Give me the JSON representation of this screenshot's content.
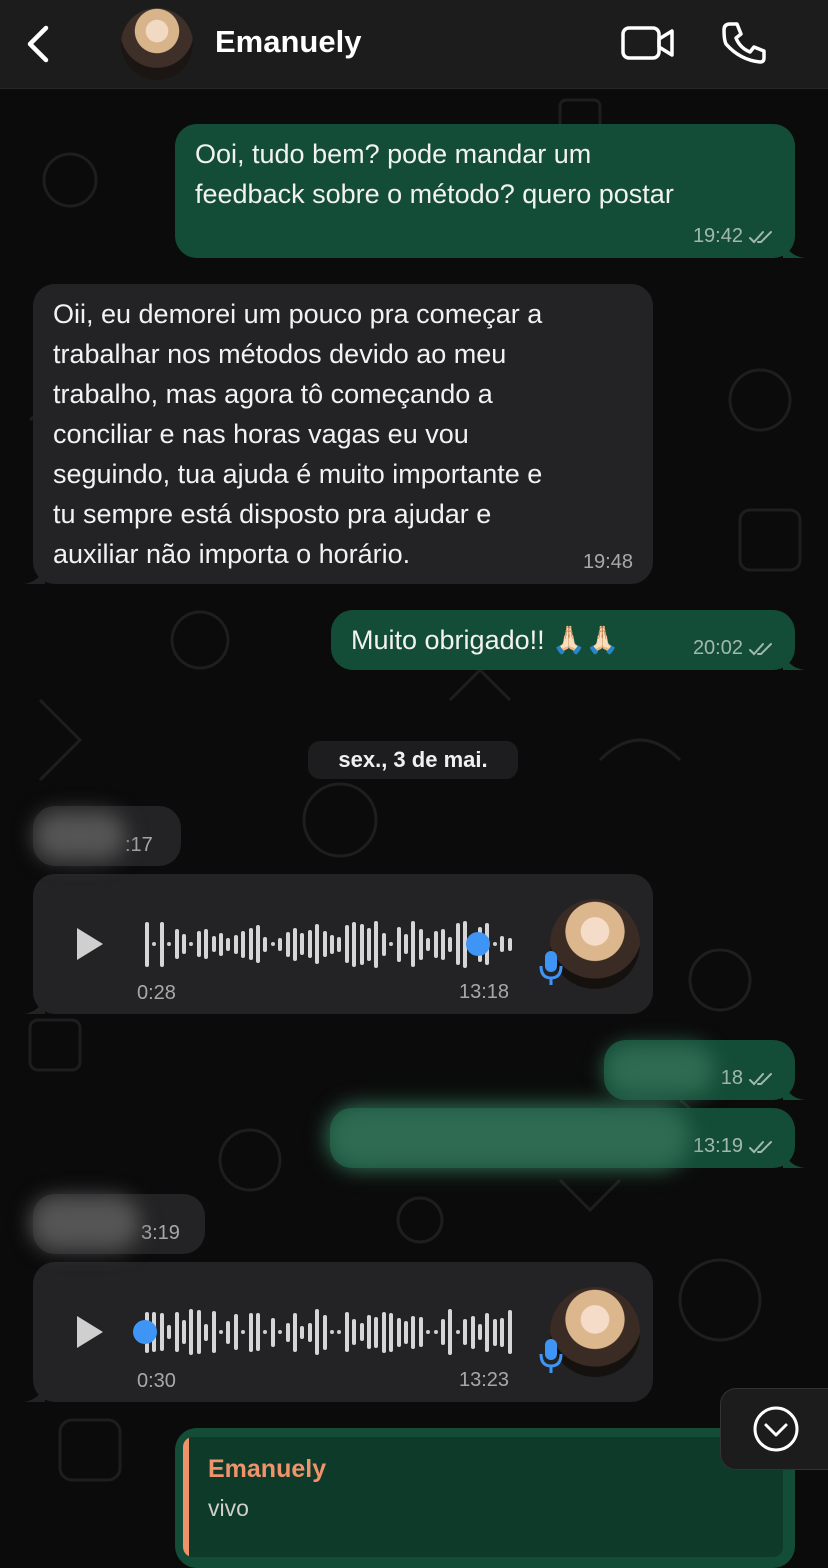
{
  "header": {
    "contact_name": "Emanuely"
  },
  "messages": [
    {
      "text": "Ooi, tudo bem? pode mandar um\nfeedback sobre o método? quero postar",
      "time": "19:42"
    },
    {
      "text": "Oii, eu demorei um pouco pra começar a\ntrabalhar nos métodos devido ao meu\ntrabalho, mas agora tô começando a\nconciliar e nas horas vagas eu vou\nseguindo, tua ajuda é muito importante e\ntu sempre está disposto pra ajudar e\nauxiliar não importa o horário.",
      "time": "19:48"
    },
    {
      "text": "Muito obrigado!! 🙏🏻🙏🏻",
      "time": "20:02"
    }
  ],
  "date_separator": "sex., 3 de mai.",
  "blurred": [
    {
      "time_fragment": ":17"
    },
    {
      "time_fragment": "18"
    },
    {
      "time_fragment": "13:19"
    },
    {
      "time_fragment": "3:19"
    }
  ],
  "voice_notes": [
    {
      "duration": "0:28",
      "time": "13:18",
      "progress": 0.9
    },
    {
      "duration": "0:30",
      "time": "13:23",
      "progress": 0.0
    }
  ],
  "reply_quote": {
    "name": "Emanuely",
    "text": "vivo"
  },
  "colors": {
    "outgoing_bubble": "#144d37",
    "incoming_bubble": "#232325",
    "accent_blue": "#3f95f5",
    "quote_name": "#f0936b"
  },
  "icons": [
    "back-arrow-icon",
    "video-call-icon",
    "phone-icon",
    "play-icon",
    "mic-icon",
    "double-check-icon",
    "chevron-down-icon"
  ]
}
